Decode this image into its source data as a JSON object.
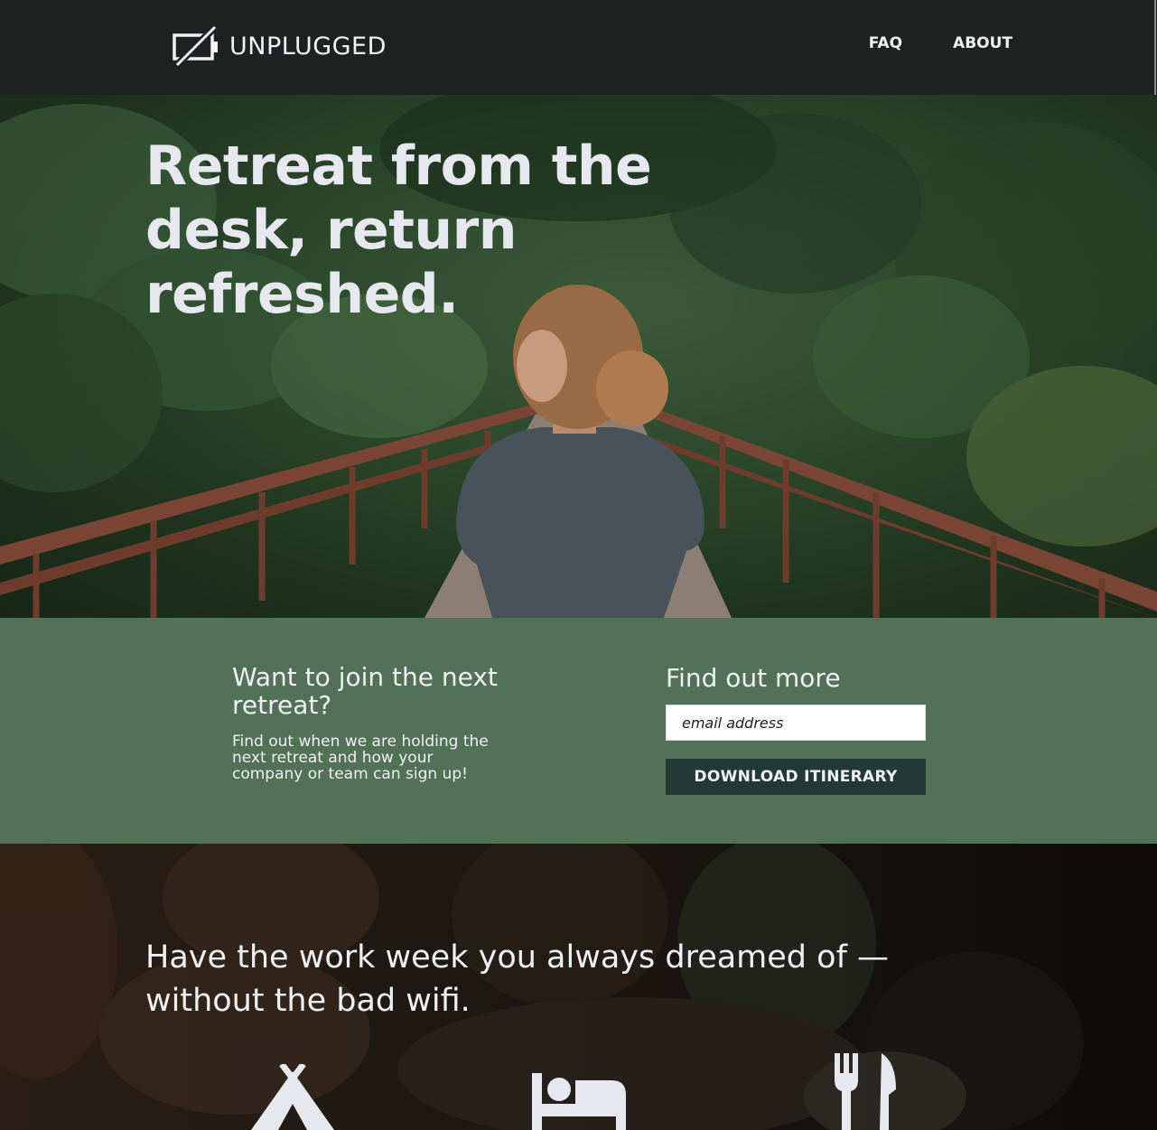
{
  "brand": {
    "name": "UNPLUGGED"
  },
  "nav": {
    "items": [
      "FAQ",
      "ABOUT"
    ]
  },
  "hero": {
    "headline": "Retreat from the desk, return refreshed."
  },
  "signup": {
    "title": "Want to join the next retreat?",
    "description": "Find out when we are holding the next retreat and how your company or team can sign up!",
    "form_title": "Find out more",
    "email_placeholder": "email address",
    "button_label": "DOWNLOAD ITINERARY"
  },
  "features": {
    "headline": "Have the work week you always dreamed of — without the bad wifi.",
    "icons": [
      "tent-icon",
      "bed-icon",
      "utensils-icon"
    ]
  },
  "colors": {
    "header_bg": "#202121",
    "band_bg": "#527156",
    "button_bg": "#223a33",
    "text_light": "#e6e7ef"
  }
}
